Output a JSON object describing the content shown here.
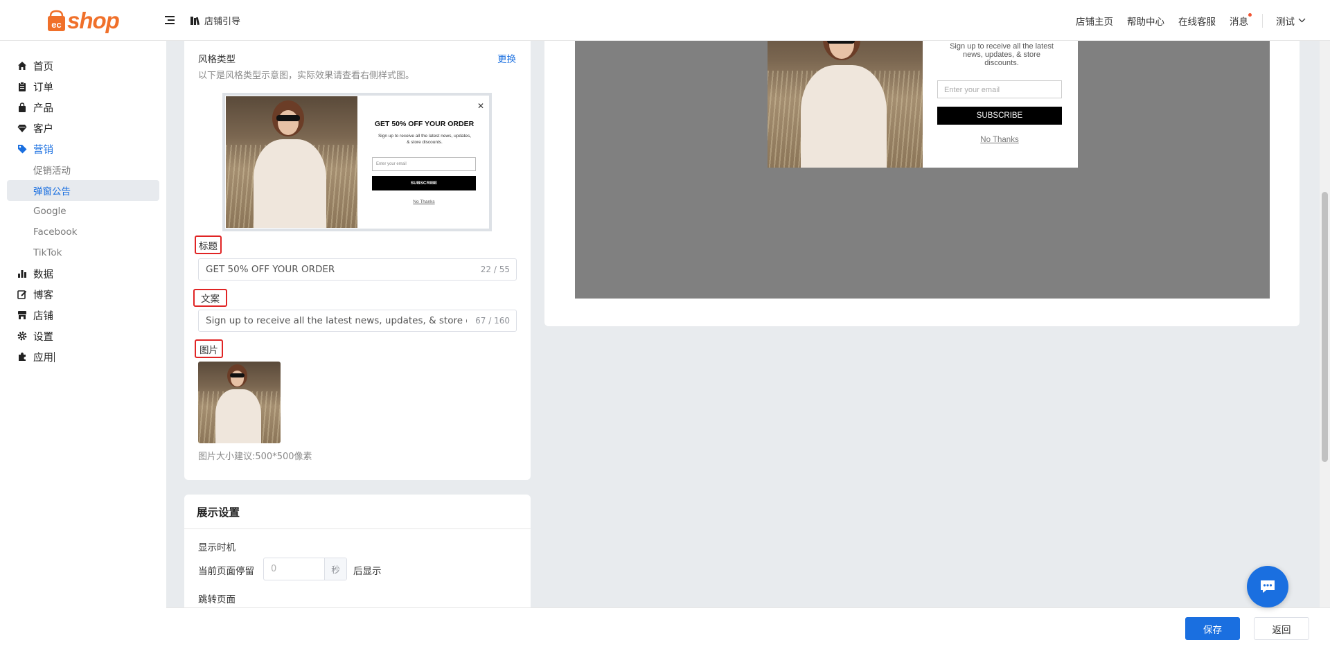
{
  "header": {
    "logo_text": "shop",
    "guide_label": "店铺引导",
    "links": [
      "店铺主页",
      "帮助中心",
      "在线客服",
      "消息"
    ],
    "user_name": "测试"
  },
  "sidebar": {
    "items": [
      {
        "label": "首页",
        "icon": "home-icon"
      },
      {
        "label": "订单",
        "icon": "clipboard-icon"
      },
      {
        "label": "产品",
        "icon": "bag-icon"
      },
      {
        "label": "客户",
        "icon": "diamond-icon"
      },
      {
        "label": "营销",
        "icon": "tag-icon"
      },
      {
        "label": "数据",
        "icon": "bar-chart-icon"
      },
      {
        "label": "博客",
        "icon": "edit-icon"
      },
      {
        "label": "店铺",
        "icon": "store-icon"
      },
      {
        "label": "设置",
        "icon": "gear-icon"
      },
      {
        "label": "应用",
        "icon": "puzzle-icon"
      }
    ],
    "marketing_sub": [
      "促销活动",
      "弹窗公告",
      "Google",
      "Facebook",
      "TikTok"
    ],
    "active_item": "营销",
    "active_sub": "弹窗公告"
  },
  "style_card": {
    "label": "风格类型",
    "change_label": "更换",
    "hint": "以下是风格类型示意图，实际效果请查看右侧样式图。",
    "thumb_title": "GET 50% OFF YOUR ORDER",
    "thumb_text": "Sign up to receive all the latest news, updates, & store discounts.",
    "thumb_placeholder": "Enter your email",
    "thumb_button": "SUBSCRIBE",
    "thumb_decline": "No Thanks",
    "title_label": "标题",
    "title_value": "GET 50% OFF YOUR ORDER",
    "title_count": "22 / 55",
    "copy_label": "文案",
    "copy_value": "Sign up to receive all the latest news, updates, & store discou",
    "copy_count": "67 / 160",
    "image_label": "图片",
    "image_hint": "图片大小建议:500*500像素"
  },
  "display_settings": {
    "title": "展示设置",
    "timing_label": "显示时机",
    "stay_label": "当前页面停留",
    "stay_value": "0",
    "unit": "秒",
    "after_label": "后显示",
    "redirect_label": "跳转页面"
  },
  "preview": {
    "text": "Sign up to receive all the latest news, updates, & store discounts.",
    "placeholder": "Enter your email",
    "button": "SUBSCRIBE",
    "decline": "No Thanks"
  },
  "footer": {
    "save_label": "保存",
    "back_label": "返回"
  },
  "colors": {
    "accent": "#1a6fe0",
    "brand": "#f0702a",
    "highlight_border": "#e02424"
  }
}
